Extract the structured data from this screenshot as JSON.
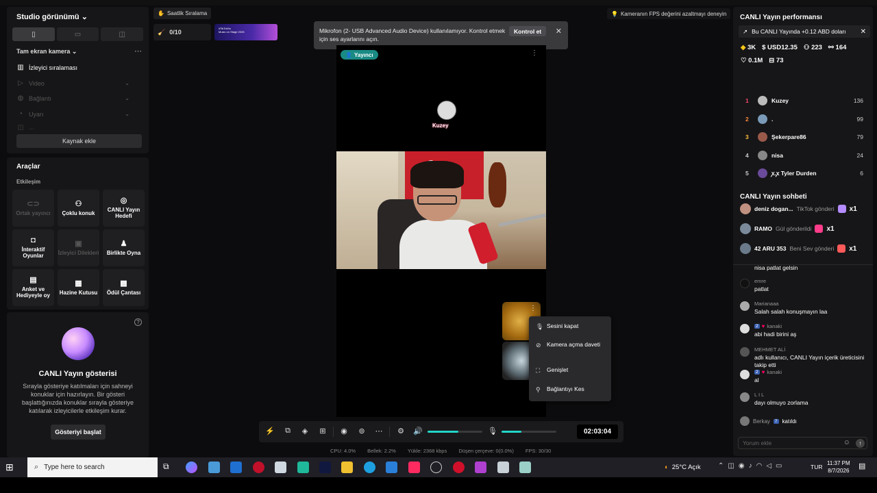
{
  "left": {
    "studio_title": "Studio görünümü",
    "source_header": "Tam ekran kamera",
    "sources": [
      {
        "label": "İzleyici sıralaması",
        "icon": "chart-icon"
      },
      {
        "label": "Video",
        "icon": "play-icon"
      },
      {
        "label": "Bağlantı",
        "icon": "globe-icon"
      },
      {
        "label": "Uyarı",
        "icon": "alert-icon"
      },
      {
        "label": "...",
        "icon": "code-icon"
      }
    ],
    "add_source": "Kaynak ekle",
    "tools_title": "Araçlar",
    "tools_subtitle": "Etkileşim",
    "tools": [
      {
        "label": "Ortak yayıncı",
        "icon": "link-icon",
        "enabled": false
      },
      {
        "label": "Çoklu konuk",
        "icon": "people-icon",
        "enabled": true
      },
      {
        "label": "CANLI Yayın Hedefi",
        "icon": "target-icon",
        "enabled": true
      },
      {
        "label": "İnteraktif Oyunlar",
        "icon": "gamepad-icon",
        "enabled": true
      },
      {
        "label": "İzleyici Dilekleri",
        "icon": "gift-icon",
        "enabled": false
      },
      {
        "label": "Birlikte Oyna",
        "icon": "player-icon",
        "enabled": true
      },
      {
        "label": "Anket ve Hediyeyle oy",
        "icon": "poll-icon",
        "enabled": true
      },
      {
        "label": "Hazine Kutusu",
        "icon": "chest-icon",
        "enabled": true
      },
      {
        "label": "Ödül Çantası",
        "icon": "bag-icon",
        "enabled": true
      }
    ],
    "show_title": "CANLI Yayın gösterisi",
    "show_desc": "Sırayla gösteriye katılmaları için sahneyi konuklar için hazırlayın. Bir gösteri başlattığınızda konuklar sırayla gösteriye katılarak izleyicilerle etkileşim kurar.",
    "show_button": "Gösteriyi başlat"
  },
  "top": {
    "ranking_label": "Saatlik Sıralama",
    "goal_label": "0/10",
    "promo_text": "#TikTok'ta\nMusic on Stage 2026",
    "toast_text": "Mikrofon (2- USB Advanced Audio Device) kullanılamıyor. Kontrol etmek için ses ayarlarını açın.",
    "toast_button": "Kontrol et",
    "fps_tip": "Kameranın FPS değerini azaltmayı deneyin"
  },
  "preview": {
    "host_badge": "Yayıncı",
    "guest_name": "Kuzey",
    "menu": [
      "Sesini kapat",
      "Kamera açma daveti",
      "Genişlet",
      "Bağlantıyı Kes"
    ]
  },
  "toolbar": {
    "timer": "02:03:04",
    "volume_level": 0.56,
    "mic_level": 0.36
  },
  "stats": {
    "cpu": "CPU: 4.0%",
    "memory": "Bellek: 2.2%",
    "upload": "Yükle: 2368 kbps",
    "dropped": "Düşen çerçeve: 0(0.0%)",
    "fps": "FPS: 30/30"
  },
  "right": {
    "perf_title": "CANLI Yayın performansı",
    "perf_note": "Bu CANLI Yayında +0.12 ABD doları",
    "metrics": {
      "diamonds": "3K",
      "usd": "USD12.35",
      "viewers": "223",
      "shares": "164",
      "likes": "0.1M",
      "gifts": "73"
    },
    "ranking": [
      {
        "rank": "1",
        "name": "Kuzey",
        "value": "136",
        "color": "#ff4b6e"
      },
      {
        "rank": "2",
        "name": ".",
        "value": "99",
        "color": "#ff8a3d"
      },
      {
        "rank": "3",
        "name": "Şekerpare86",
        "value": "79",
        "color": "#ffbe3d"
      },
      {
        "rank": "4",
        "name": "nisa",
        "value": "24",
        "color": "#cccccc"
      },
      {
        "rank": "5",
        "name": "ꭗ.ꭗ Tyler Durden",
        "value": "6",
        "color": "#cccccc"
      }
    ],
    "chat_title": "CANLI Yayın sohbeti",
    "gifts": [
      {
        "name": "deniz dogan...",
        "action": "TikTok gönderi",
        "count": "x1",
        "gift_color": "#b58cff"
      },
      {
        "name": "RAMO",
        "action": "Gül gönderildi",
        "count": "x1",
        "gift_color": "#ff3c8a"
      },
      {
        "name": "42 ARU 353",
        "action": "Beni Sev gönderi",
        "count": "x1",
        "gift_color": "#ff5a5a"
      }
    ],
    "messages": [
      {
        "user": "",
        "text": "nisa patlat gelsin"
      },
      {
        "user": "emre",
        "text": "patlat"
      },
      {
        "user": "Marianaaa",
        "text": "Salah salah konuşmayın laa"
      },
      {
        "user": "kanaki",
        "badge": "2",
        "text": "abi hadi birini aş"
      },
      {
        "user": "MEHMET ALİ",
        "text": "adlı kullanıcı, CANLI Yayın içerik üreticisini takip etti"
      },
      {
        "user": "kanaki",
        "badge": "2",
        "text": "al"
      },
      {
        "user": "L I L",
        "text": "dayı olmuyo zorlama"
      }
    ],
    "join": {
      "user": "Berkay",
      "badge": "7",
      "text": "katıldı"
    },
    "chat_placeholder": "Yorum ekle"
  },
  "taskbar": {
    "search_placeholder": "Type here to search",
    "weather": "25°C  Açık",
    "lang": "TUR",
    "time": "11:37 PM",
    "date": "8/7/2026"
  }
}
